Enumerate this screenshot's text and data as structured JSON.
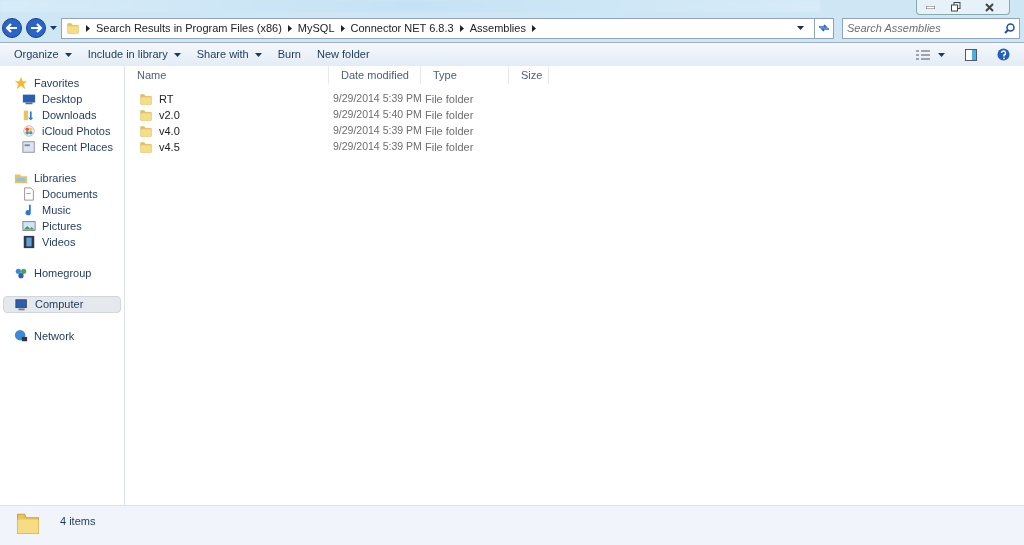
{
  "address_bar": {
    "breadcrumbs": [
      "Search Results in Program Files (x86)",
      "MySQL",
      "Connector NET 6.8.3",
      "Assemblies"
    ]
  },
  "search": {
    "placeholder": "Search Assemblies"
  },
  "toolbar": {
    "buttons": [
      {
        "label": "Organize",
        "dropdown": true
      },
      {
        "label": "Include in library",
        "dropdown": true
      },
      {
        "label": "Share with",
        "dropdown": true
      },
      {
        "label": "Burn",
        "dropdown": false
      },
      {
        "label": "New folder",
        "dropdown": false
      }
    ]
  },
  "sidebar": {
    "groups": [
      {
        "label": "Favorites",
        "kind": "star",
        "selected": false,
        "children": [
          {
            "label": "Desktop",
            "kind": "desktop",
            "selected": false
          },
          {
            "label": "Downloads",
            "kind": "downloads",
            "selected": false
          },
          {
            "label": "iCloud Photos",
            "kind": "photos",
            "selected": false
          },
          {
            "label": "Recent Places",
            "kind": "recent",
            "selected": false
          }
        ]
      },
      {
        "label": "Libraries",
        "kind": "libraries",
        "selected": false,
        "children": [
          {
            "label": "Documents",
            "kind": "document",
            "selected": false
          },
          {
            "label": "Music",
            "kind": "music",
            "selected": false
          },
          {
            "label": "Pictures",
            "kind": "pictures",
            "selected": false
          },
          {
            "label": "Videos",
            "kind": "videos",
            "selected": false
          }
        ]
      },
      {
        "label": "Homegroup",
        "kind": "homegroup",
        "selected": false
      },
      {
        "label": "Computer",
        "kind": "computer",
        "selected": true
      },
      {
        "label": "Network",
        "kind": "network",
        "selected": false
      }
    ]
  },
  "table": {
    "columns": [
      "Name",
      "Date modified",
      "Type",
      "Size"
    ],
    "rows": [
      {
        "name": "RT",
        "date_modified": "9/29/2014 5:39 PM",
        "type": "File folder"
      },
      {
        "name": "v2.0",
        "date_modified": "9/29/2014 5:40 PM",
        "type": "File folder"
      },
      {
        "name": "v4.0",
        "date_modified": "9/29/2014 5:39 PM",
        "type": "File folder"
      },
      {
        "name": "v4.5",
        "date_modified": "9/29/2014 5:39 PM",
        "type": "File folder"
      }
    ]
  },
  "status_bar": {
    "count": "4 items"
  }
}
